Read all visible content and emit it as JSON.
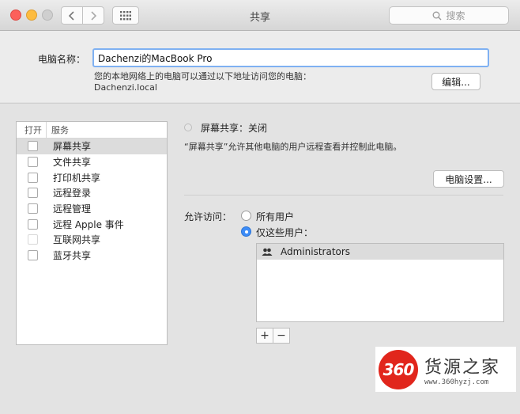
{
  "window": {
    "title": "共享"
  },
  "search": {
    "placeholder": "搜索"
  },
  "computer_name": {
    "label": "电脑名称：",
    "value": "Dachenzi的MacBook Pro",
    "note_line1": "您的本地网络上的电脑可以通过以下地址访问您的电脑：",
    "note_line2": "Dachenzi.local",
    "edit_label": "编辑..."
  },
  "services": {
    "col_open": "打开",
    "col_service": "服务",
    "items": [
      {
        "label": "屏幕共享",
        "checked": false,
        "selected": true
      },
      {
        "label": "文件共享",
        "checked": false
      },
      {
        "label": "打印机共享",
        "checked": false
      },
      {
        "label": "远程登录",
        "checked": false
      },
      {
        "label": "远程管理",
        "checked": false
      },
      {
        "label": "远程 Apple 事件",
        "checked": false
      },
      {
        "label": "互联网共享",
        "checked": false
      },
      {
        "label": "蓝牙共享",
        "checked": false
      }
    ]
  },
  "detail": {
    "status": "屏幕共享：关闭",
    "description": "“屏幕共享”允许其他电脑的用户远程查看并控制此电脑。",
    "computer_settings_label": "电脑设置...",
    "allow_label": "允许访问：",
    "option_all": "所有用户",
    "option_only": "仅这些用户：",
    "users": [
      "Administrators"
    ],
    "add_label": "+",
    "remove_label": "−"
  },
  "watermark": {
    "badge": "360",
    "name": "货源之家",
    "url": "www.360hyzj.com"
  }
}
